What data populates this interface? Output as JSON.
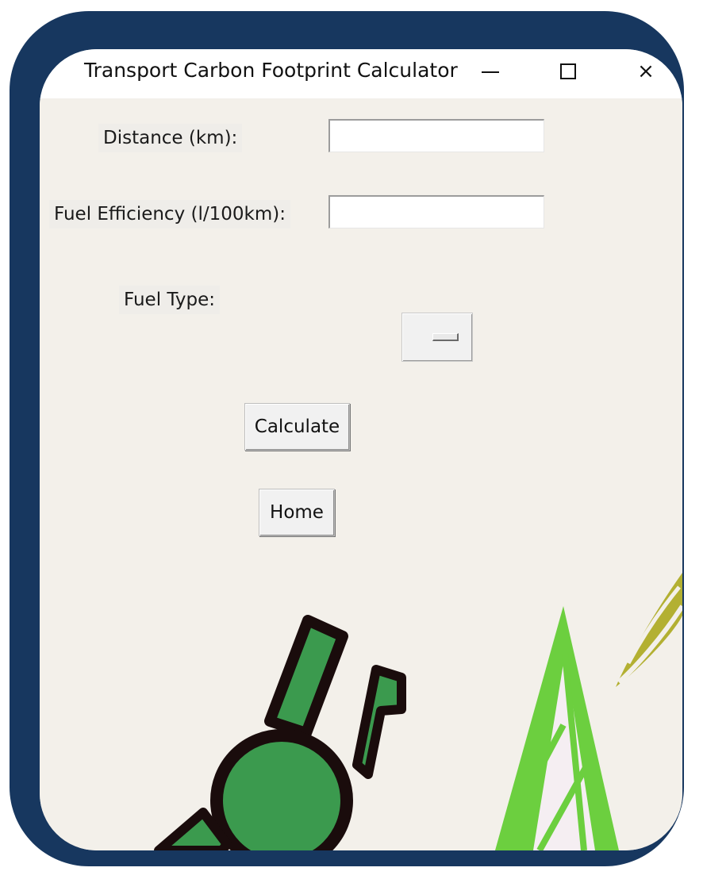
{
  "window": {
    "title": "Transport Carbon Footprint Calculator",
    "controls": {
      "minimize_icon": "minimize-icon",
      "maximize_icon": "maximize-icon",
      "close_icon": "close-icon",
      "close_glyph": "×"
    }
  },
  "form": {
    "distance_label": "Distance (km):",
    "distance_value": "",
    "efficiency_label": "Fuel Efficiency (l/100km):",
    "efficiency_value": "",
    "fuel_type_label": "Fuel Type:",
    "fuel_type_selected": ""
  },
  "buttons": {
    "calculate_label": "Calculate",
    "home_label": "Home"
  },
  "colors": {
    "frame": "#17375f",
    "background": "#f3f0ea",
    "leaf_green": "#6ccf3f",
    "figure_green": "#3b9a4e",
    "olive_leaf": "#b3b032"
  }
}
